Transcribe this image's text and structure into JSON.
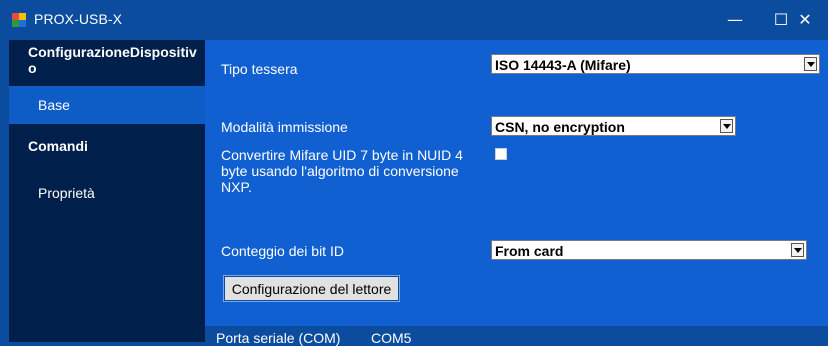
{
  "window": {
    "title": "PROX-USB-X"
  },
  "sidebar": {
    "items": [
      {
        "label": "ConfigurazioneDispositivo"
      },
      {
        "label": "Base"
      },
      {
        "label": "Comandi"
      },
      {
        "label": "Proprietà"
      }
    ]
  },
  "form": {
    "card_type": {
      "label": "Tipo tessera",
      "value": "ISO 14443-A (Mifare)"
    },
    "input_mode": {
      "label": "Modalità immissione",
      "value": "CSN, no encryption"
    },
    "convert_uid": {
      "label": "Convertire Mifare UID 7 byte in NUID 4 byte usando l'algoritmo di conversione NXP.",
      "checked": false
    },
    "id_bit_count": {
      "label": "Conteggio dei bit ID",
      "value": "From card"
    },
    "configure_button": "Configurazione del lettore"
  },
  "status": {
    "port_label": "Porta seriale (COM)",
    "port_value": "COM5"
  },
  "colors": {
    "titlebar": "#0b4c9e",
    "sidebar": "#001f4a",
    "sidebar_active": "#0e5cc6",
    "main": "#1160d1"
  }
}
